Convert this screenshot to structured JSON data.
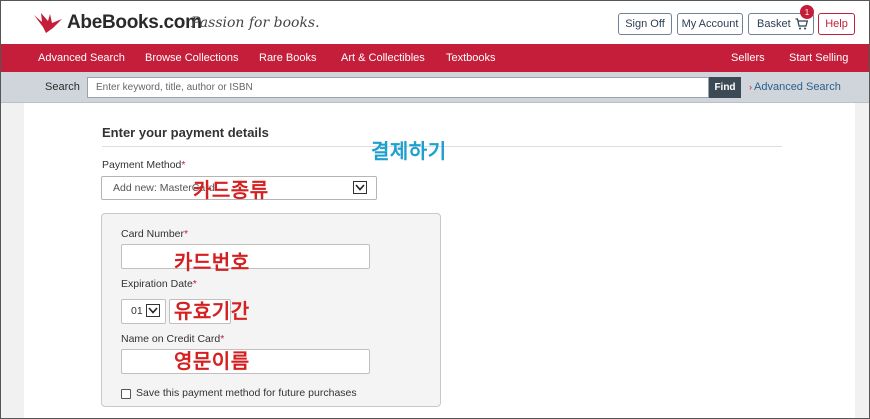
{
  "header": {
    "logo_text": "AbeBooks.com",
    "tagline": "Passion for books.",
    "sign_off": "Sign Off",
    "my_account": "My Account",
    "basket": "Basket",
    "basket_count": "1",
    "help": "Help",
    "brand_color": "#c41e3a"
  },
  "nav": {
    "items": [
      "Advanced Search",
      "Browse Collections",
      "Rare Books",
      "Art & Collectibles",
      "Textbooks",
      "Sellers",
      "Start Selling"
    ]
  },
  "search": {
    "label": "Search",
    "placeholder": "Enter keyword, title, author or ISBN",
    "find": "Find",
    "advanced_link": "Advanced Search"
  },
  "payment": {
    "title": "Enter your payment details",
    "method_label": "Payment Method",
    "method_value": "Add new: MasterCard",
    "card_number_label": "Card Number",
    "card_number_value": "",
    "expiration_label": "Expiration Date",
    "exp_month": "01",
    "name_label": "Name on Credit Card",
    "name_value": "",
    "required_mark": "*",
    "save_label": "Save this payment method for future purchases"
  },
  "annotations": {
    "checkout": "결제하기",
    "card_type": "카드종류",
    "card_number": "카드번호",
    "expiry": "유효기간",
    "english_name": "영문이름"
  }
}
